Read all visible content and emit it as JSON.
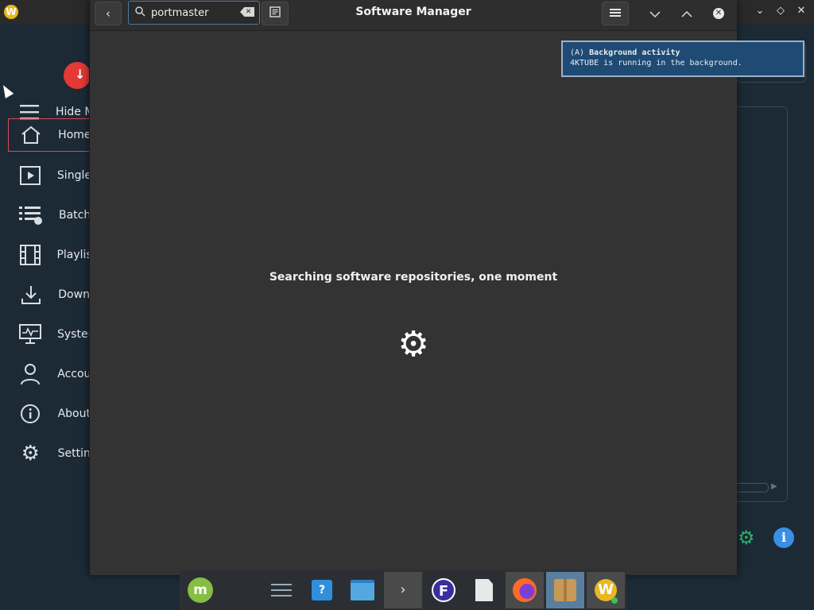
{
  "background_app": {
    "nav": [
      {
        "label": "Hide M",
        "icon": "menu-icon"
      },
      {
        "label": "Home",
        "icon": "home-icon",
        "active": true
      },
      {
        "label": "Single",
        "icon": "play-icon"
      },
      {
        "label": "Batch",
        "icon": "list-icon"
      },
      {
        "label": "Playlis",
        "icon": "film-icon"
      },
      {
        "label": "Down",
        "icon": "download-icon"
      },
      {
        "label": "Syster",
        "icon": "monitor-icon"
      },
      {
        "label": "Accou",
        "icon": "user-icon"
      },
      {
        "label": "About",
        "icon": "info-icon"
      },
      {
        "label": "Settin",
        "icon": "gear-icon"
      }
    ]
  },
  "software_manager": {
    "title": "Software Manager",
    "search": {
      "value": "portmaster"
    },
    "status_message": "Searching software repositories, one moment"
  },
  "notification": {
    "prefix": "(A)",
    "title": "Background activity",
    "body": "4KTUBE is running in the background."
  },
  "taskbar": {
    "items": [
      "mint-menu-icon",
      "system-settings-icon",
      "software-store-icon",
      "file-manager-icon",
      "terminal-icon",
      "flatpak-app-icon",
      "text-editor-icon",
      "firefox-icon",
      "software-manager-icon",
      "4k-tube-icon"
    ]
  },
  "colors": {
    "accent": "#4e7aa6",
    "active_nav_border": "#d84a5a",
    "notification_bg": "#1f4a73"
  }
}
